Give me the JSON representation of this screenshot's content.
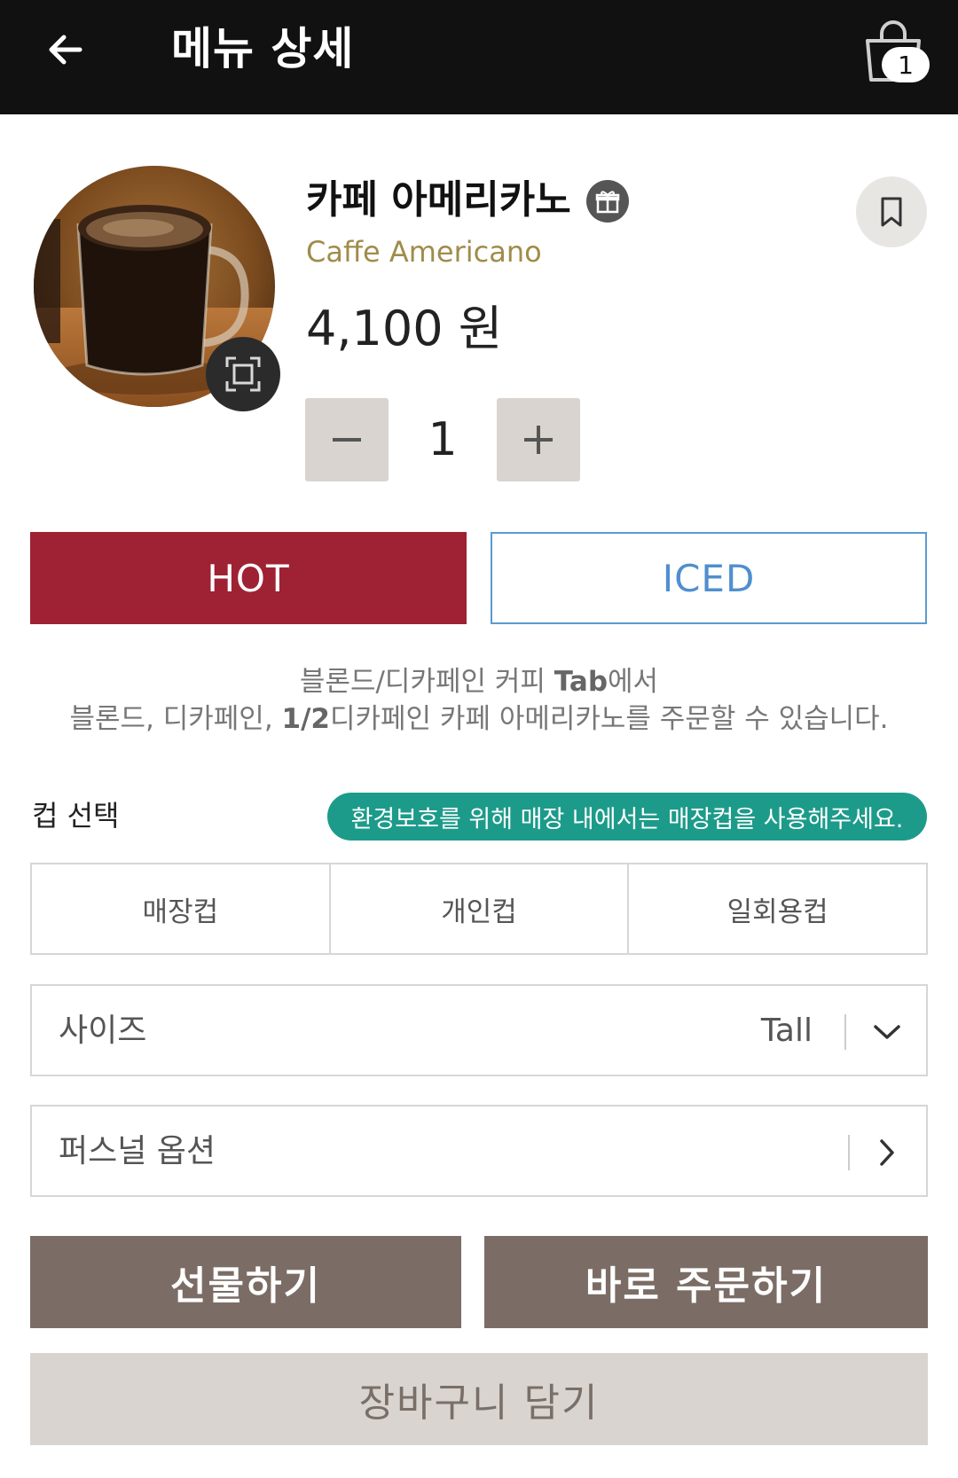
{
  "header": {
    "title": "메뉴 상세",
    "cart_count": "1"
  },
  "product": {
    "name_ko": "카페 아메리카노",
    "name_en": "Caffe Americano",
    "price": "4,100 원",
    "quantity": "1"
  },
  "temperature": {
    "hot_label": "HOT",
    "iced_label": "ICED",
    "selected": "HOT"
  },
  "info": {
    "line1_prefix": "블론드/디카페인 커피 ",
    "line1_bold": "Tab",
    "line1_suffix": "에서",
    "line2_prefix": "블론드, 디카페인, ",
    "line2_bold": "1/2",
    "line2_suffix": "디카페인 카페 아메리카노를 주문할 수 있습니다."
  },
  "cup": {
    "label": "컵 선택",
    "eco_notice": "환경보호를 위해 매장 내에서는 매장컵을 사용해주세요.",
    "options": [
      "매장컵",
      "개인컵",
      "일회용컵"
    ]
  },
  "size": {
    "label": "사이즈",
    "value": "Tall"
  },
  "personal_option": {
    "label": "퍼스널 옵션"
  },
  "actions": {
    "gift": "선물하기",
    "order_now": "바로 주문하기",
    "add_to_cart": "장바구니 담기"
  },
  "colors": {
    "header_bg": "#111111",
    "hot": "#9e2233",
    "iced": "#4f8fce",
    "eco_badge": "#1d9b8a",
    "action_button": "#7b6d66",
    "cart_button": "#d9d4cf",
    "english_name": "#a08c4a"
  },
  "icons": {
    "back": "arrow-left-icon",
    "cart": "shopping-bag-icon",
    "gift": "gift-icon",
    "bookmark": "bookmark-icon",
    "zoom": "expand-icon",
    "size_dropdown": "chevron-down-icon",
    "personal_option": "chevron-right-icon"
  }
}
